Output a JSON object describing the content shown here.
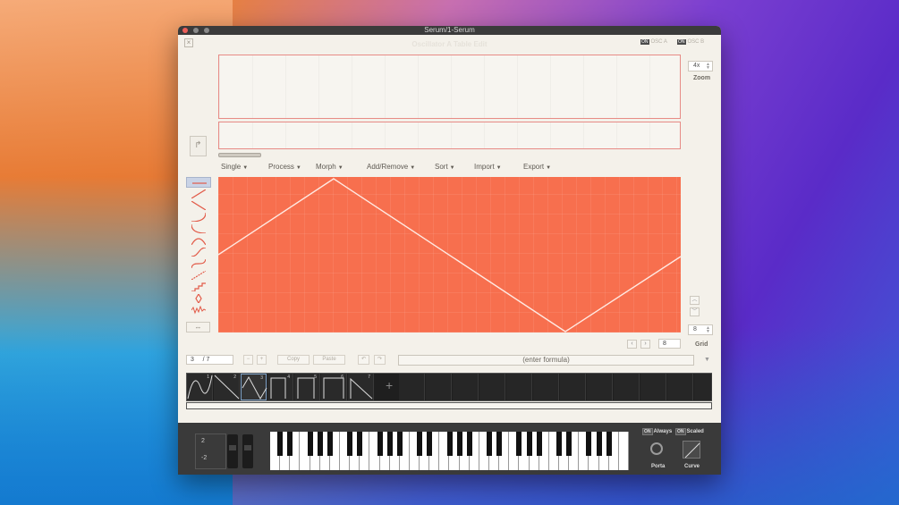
{
  "window": {
    "title": "Serum/1-Serum",
    "editor_title": "Oscillator A Table Edit",
    "close_label": "×"
  },
  "osc_toggles": [
    {
      "on": "ON",
      "label": "OSC A"
    },
    {
      "on": "ON",
      "label": "OSC B"
    }
  ],
  "zoom": {
    "value": "4x",
    "label": "Zoom"
  },
  "grid": {
    "value": "8",
    "label": "Grid"
  },
  "menus": [
    {
      "label": "Single"
    },
    {
      "label": "Process"
    },
    {
      "label": "Morph"
    },
    {
      "label": "Add/Remove"
    },
    {
      "label": "Sort"
    },
    {
      "label": "Import"
    },
    {
      "label": "Export"
    }
  ],
  "icons": {
    "menu_arrow": "▼",
    "up": "︿",
    "down": "﹀",
    "prev": "‹",
    "next": "›",
    "plus": "+",
    "dropdown": "▼",
    "side_tool": "↱",
    "fit": "↔"
  },
  "nav": {
    "step_value": "8"
  },
  "frame_nav": {
    "current": "3",
    "separator": "/",
    "total": "7"
  },
  "toolbar": {
    "minus": "−",
    "plus": "+",
    "copy": "Copy",
    "paste": "Paste",
    "undo": "↶",
    "redo": "↷"
  },
  "formula": {
    "placeholder": "(enter formula)"
  },
  "wavetable_frames": [
    {
      "num": "1"
    },
    {
      "num": "2"
    },
    {
      "num": "3"
    },
    {
      "num": "4"
    },
    {
      "num": "5"
    },
    {
      "num": "6"
    },
    {
      "num": "7"
    }
  ],
  "selected_frame": 3,
  "keyboard": {
    "pitch_up": "2",
    "pitch_down": "-2",
    "always": {
      "on": "ON",
      "label": "Always"
    },
    "scaled": {
      "on": "ON",
      "label": "Scaled"
    },
    "porta_label": "Porta",
    "curve_label": "Curve"
  },
  "colors": {
    "wave_bg": "#f76f4e",
    "accent": "#e78b86",
    "selection": "#c9d3e6"
  }
}
